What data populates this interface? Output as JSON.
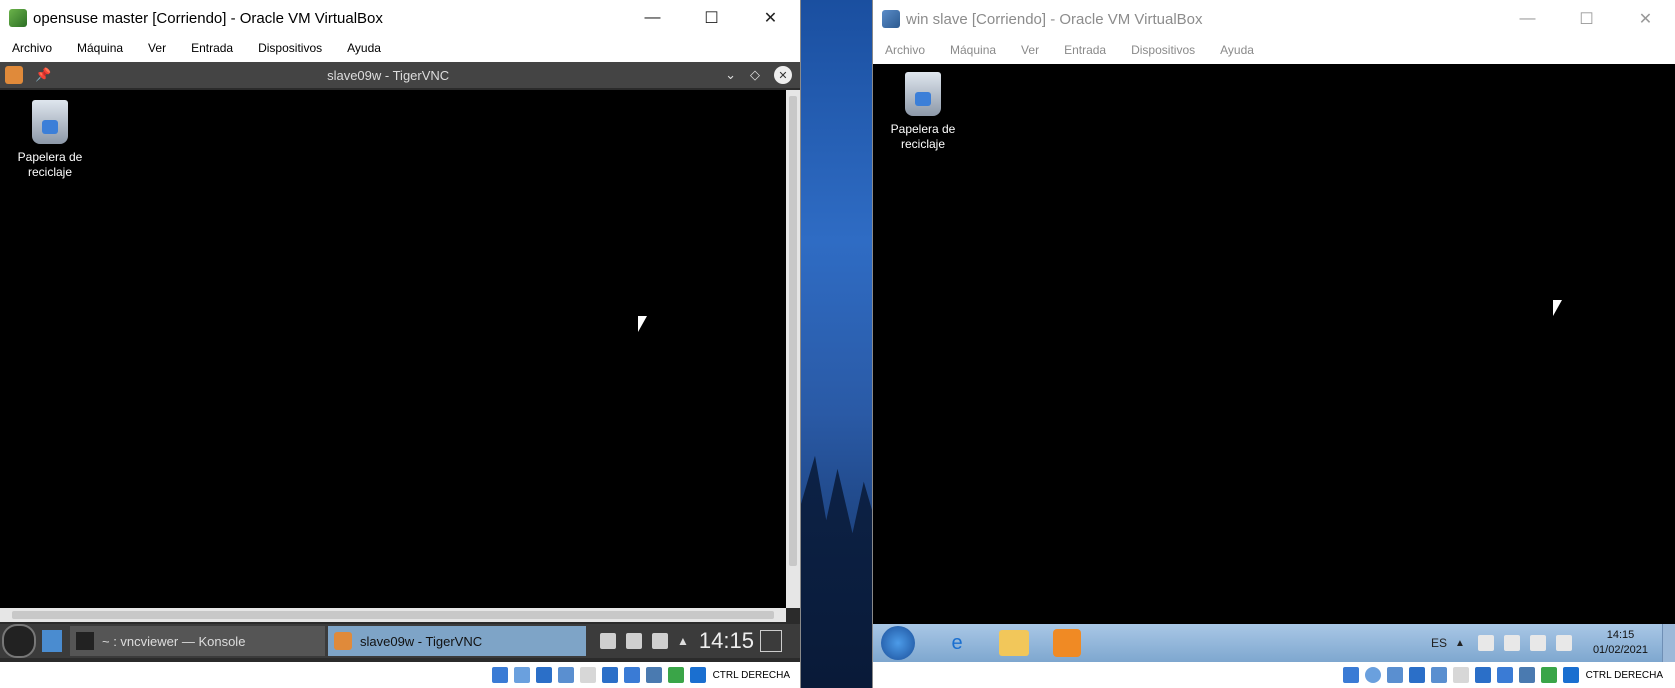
{
  "left_window": {
    "title": "opensuse master [Corriendo] - Oracle VM VirtualBox",
    "menu": [
      "Archivo",
      "Máquina",
      "Ver",
      "Entrada",
      "Dispositivos",
      "Ayuda"
    ],
    "vnc_title": "slave09w - TigerVNC",
    "desktop_icon_label": "Papelera de reciclaje",
    "taskbar": {
      "konsole": "~ : vncviewer — Konsole",
      "tigervnc": "slave09w - TigerVNC",
      "clock": "14:15"
    },
    "host_key": "CTRL DERECHA"
  },
  "right_window": {
    "title": "win slave [Corriendo] - Oracle VM VirtualBox",
    "menu": [
      "Archivo",
      "Máquina",
      "Ver",
      "Entrada",
      "Dispositivos",
      "Ayuda"
    ],
    "desktop_icon_label": "Papelera de reciclaje",
    "taskbar": {
      "lang": "ES",
      "time": "14:15",
      "date": "01/02/2021"
    },
    "host_key": "CTRL DERECHA"
  },
  "caption_buttons": {
    "minimize": "—",
    "maximize": "☐",
    "close": "✕"
  },
  "colors": {
    "guest_screen": "#000000",
    "win7_taskbar": "#8fb4da",
    "kde_taskbar": "#3b3b3b"
  }
}
